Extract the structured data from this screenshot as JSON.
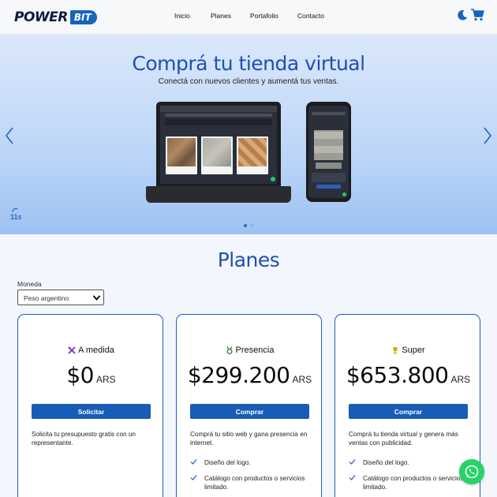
{
  "header": {
    "logo_power": "POWER",
    "logo_bit": "BIT",
    "nav": [
      "Inicio",
      "Planes",
      "Portafolio",
      "Contacto"
    ]
  },
  "hero": {
    "title": "Comprá tu tienda virtual",
    "subtitle": "Conectá con nuevos clientes y aumentá tus ventas.",
    "timer": "11s",
    "slides_total": 2,
    "active_slide": 1
  },
  "plans": {
    "title": "Planes",
    "currency_label": "Moneda",
    "currency_selected": "Peso argentino",
    "cards": [
      {
        "icon": "tools-icon",
        "name": "A medida",
        "price": "$0",
        "currency": "ARS",
        "button": "Solicitar",
        "description": "Solicita tu presupuesto gratis con un representante.",
        "features": []
      },
      {
        "icon": "medal-icon",
        "name": "Presencia",
        "price": "$299.200",
        "currency": "ARS",
        "button": "Comprar",
        "description": "Comprá tu sitio web y gana presencia en internet.",
        "features": [
          "Diseño del logo.",
          "Catálogo con productos o servicios limitado."
        ]
      },
      {
        "icon": "trophy-icon",
        "name": "Super",
        "price": "$653.800",
        "currency": "ARS",
        "button": "Comprar",
        "description": "Comprá tu tienda virtual y genera más ventas con publicidad.",
        "features": [
          "Diseño del logo.",
          "Catálogo con productos o servicios limitado."
        ]
      }
    ]
  },
  "colors": {
    "accent": "#1f5cc4",
    "button": "#175cb6",
    "whatsapp": "#25d366"
  }
}
